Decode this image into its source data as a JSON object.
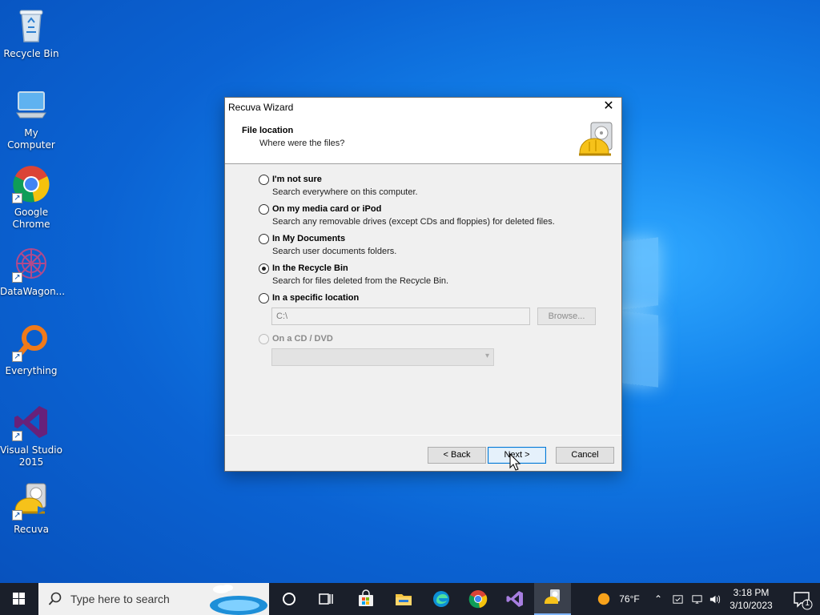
{
  "desktop": {
    "icons": [
      {
        "label": "Recycle Bin",
        "icon": "recycle-bin-icon"
      },
      {
        "label": "My Computer",
        "icon": "computer-icon"
      },
      {
        "label": "Google Chrome",
        "icon": "chrome-icon"
      },
      {
        "label": "DataWagon...",
        "icon": "datawagon-icon"
      },
      {
        "label": "Everything",
        "icon": "everything-search-icon"
      },
      {
        "label": "Visual Studio 2015",
        "icon": "visual-studio-icon"
      },
      {
        "label": "Recuva",
        "icon": "recuva-icon"
      }
    ]
  },
  "dialog": {
    "title": "Recuva Wizard",
    "close_glyph": "✕",
    "header_title": "File location",
    "header_subtitle": "Where were the files?",
    "options": [
      {
        "label": "I'm not sure",
        "desc": "Search everywhere on this computer.",
        "checked": false,
        "enabled": true
      },
      {
        "label": "On my media card or iPod",
        "desc": "Search any removable drives (except CDs and floppies) for deleted files.",
        "checked": false,
        "enabled": true
      },
      {
        "label": "In My Documents",
        "desc": "Search user documents folders.",
        "checked": false,
        "enabled": true
      },
      {
        "label": "In the Recycle Bin",
        "desc": "Search for files deleted from the Recycle Bin.",
        "checked": true,
        "enabled": true
      },
      {
        "label": "In a specific location",
        "desc": "",
        "checked": false,
        "enabled": true
      },
      {
        "label": "On a CD / DVD",
        "desc": "",
        "checked": false,
        "enabled": false
      }
    ],
    "location_value": "C:\\",
    "browse_label": "Browse...",
    "cd_value": "",
    "back_label": "< Back",
    "next_label": "Next >",
    "cancel_label": "Cancel"
  },
  "taskbar": {
    "search_placeholder": "Type here to search",
    "apps": [
      "task-view-icon",
      "widgets-icon",
      "store-icon",
      "file-explorer-icon",
      "edge-icon",
      "chrome-icon",
      "visual-studio-icon",
      "recuva-icon"
    ],
    "weather": "76°F",
    "time": "3:18 PM",
    "date": "3/10/2023",
    "notification_count": "1"
  },
  "colors": {
    "accent": "#0078d7",
    "wallpaper": "#0b63d3",
    "taskbar": "#1a1f2a"
  }
}
